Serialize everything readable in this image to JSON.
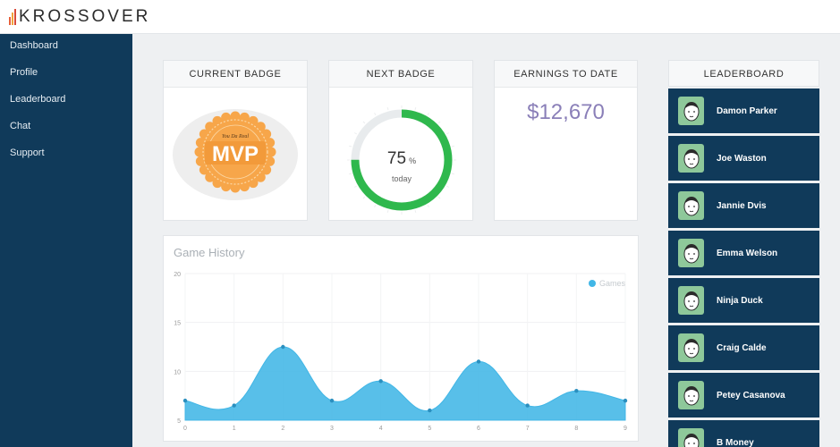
{
  "brand": {
    "name": "KROSSOVER",
    "bar_colors": [
      "#e8603c",
      "#f0a33c",
      "#d94a3a",
      "#2b2b2b"
    ]
  },
  "sidebar": {
    "items": [
      {
        "label": "Dashboard"
      },
      {
        "label": "Profile"
      },
      {
        "label": "Leaderboard"
      },
      {
        "label": "Chat"
      },
      {
        "label": "Support"
      }
    ]
  },
  "current_badge": {
    "title": "CURRENT BADGE",
    "badge_tagline": "You Da Real",
    "badge_text": "MVP"
  },
  "next_badge": {
    "title": "NEXT BADGE",
    "progress_value": "75",
    "progress_unit": "%",
    "progress_sub": "today",
    "progress_fraction": 0.75
  },
  "earnings": {
    "title": "EARNINGS TO DATE",
    "value": "$12,670"
  },
  "game_history": {
    "title": "Game History"
  },
  "chart_data": {
    "type": "area",
    "title": "Game History",
    "x": [
      0,
      1,
      2,
      3,
      4,
      5,
      6,
      7,
      8,
      9
    ],
    "series": [
      {
        "name": "Games",
        "values": [
          7,
          6.5,
          12.5,
          7,
          9,
          6,
          11,
          6.5,
          8,
          7
        ]
      }
    ],
    "ylim": [
      5,
      20
    ],
    "yticks": [
      5,
      10,
      15,
      20
    ],
    "xticks": [
      0,
      1,
      2,
      3,
      4,
      5,
      6,
      7,
      8,
      9
    ],
    "grid": true,
    "legend": "top-right",
    "color": "#41b6e6"
  },
  "leaderboard": {
    "title": "LEADERBOARD",
    "players": [
      {
        "name": "Damon Parker"
      },
      {
        "name": "Joe Waston"
      },
      {
        "name": "Jannie Dvis"
      },
      {
        "name": "Emma Welson"
      },
      {
        "name": "Ninja Duck"
      },
      {
        "name": "Craig Calde"
      },
      {
        "name": "Petey Casanova"
      },
      {
        "name": "B Money"
      }
    ]
  }
}
